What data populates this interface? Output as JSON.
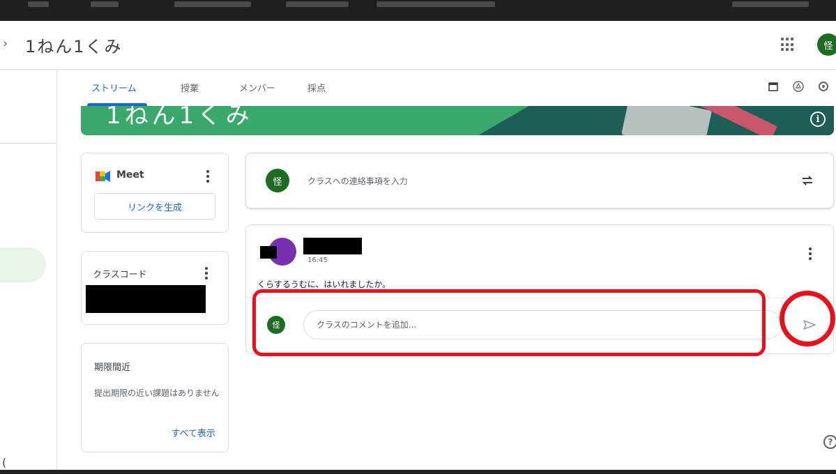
{
  "header": {
    "class_name": "1ねん1くみ",
    "user_initial": "怪"
  },
  "tabs": [
    {
      "label": "ストリーム",
      "active": true
    },
    {
      "label": "授業",
      "active": false
    },
    {
      "label": "メンバー",
      "active": false
    },
    {
      "label": "採点",
      "active": false
    }
  ],
  "banner": {
    "title": "1ねん1くみ"
  },
  "meet": {
    "name": "Meet",
    "generate_link": "リンクを生成"
  },
  "class_code": {
    "label": "クラスコード"
  },
  "due_soon": {
    "title": "期限間近",
    "message": "提出期限の近い課題はありません",
    "view_all": "すべて表示"
  },
  "announce": {
    "user_initial": "怪",
    "placeholder": "クラスへの連絡事項を入力"
  },
  "post": {
    "time": "16:45",
    "body": "くらするうむに、はいれましたか。",
    "comment_initial": "怪",
    "comment_placeholder": "クラスのコメントを追加..."
  },
  "colors": {
    "accent": "#1967d2",
    "banner": "#3aa86a",
    "avatar_green": "#1e6b24",
    "highlight_red": "#e8101a"
  },
  "icons": {
    "apps": "apps-grid-icon",
    "calendar": "calendar-icon",
    "drive": "drive-icon",
    "settings": "settings-icon",
    "info": "info-icon",
    "repost": "repost-icon",
    "send": "send-icon",
    "help": "help-icon"
  }
}
